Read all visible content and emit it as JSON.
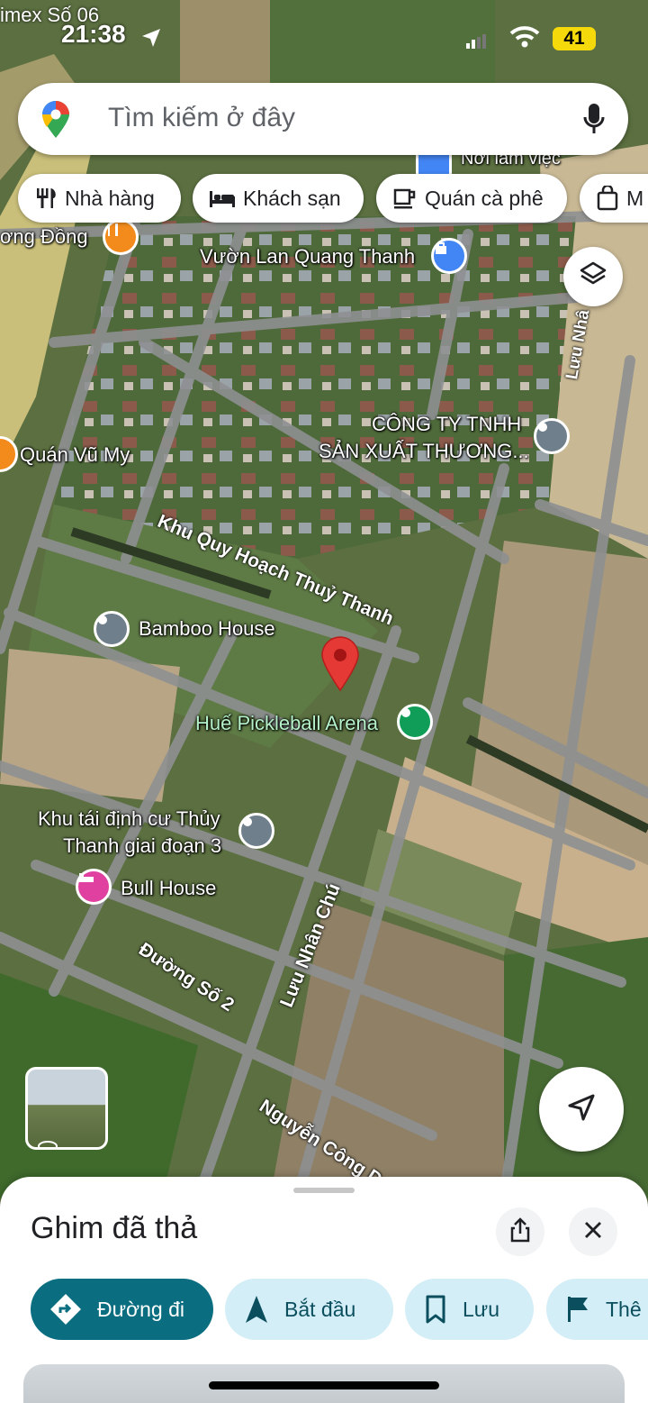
{
  "status_bar": {
    "time": "21:38",
    "battery": "41",
    "top_left_partial": "imex Số 06"
  },
  "search": {
    "placeholder": "Tìm kiếm ở đây"
  },
  "chips": [
    {
      "label": "Nhà hàng",
      "icon": "restaurant-icon"
    },
    {
      "label": "Khách sạn",
      "icon": "hotel-bed-icon"
    },
    {
      "label": "Quán cà phê",
      "icon": "coffee-cup-icon"
    },
    {
      "label": "M",
      "icon": "shopping-bag-icon"
    }
  ],
  "map_labels": {
    "noi_lam_viec": "Nơi làm việc",
    "suong_dong": "ơng Đồng",
    "vuon_lan": "Vườn Lan Quang Thanh",
    "luu_nhan_top": "Lưu Nhâ",
    "cong_ty_1": "CÔNG TY TNHH",
    "cong_ty_2": "SẢN XUẤT THƯƠNG...",
    "quan_vu_my": "Quán Vũ My",
    "khu_quy_hoach": "Khu Quy Hoạch Thuỷ Thanh",
    "bamboo_house": "Bamboo House",
    "pickleball": "Huế Pickleball Arena",
    "khu_tai_dinh_cu_1": "Khu tái định cư Thủy",
    "khu_tai_dinh_cu_2": "Thanh giai đoạn 3",
    "bull_house": "Bull House",
    "duong_so_2": "Đường Số 2",
    "luu_nhan_chu": "Lưu Nhân Chú",
    "nguyen_cong_duan": "Nguyễn Công Duẩ"
  },
  "colors": {
    "accent_teal": "#0b6e80",
    "chip_light_blue": "#d3eef7",
    "pin_red": "#e53935",
    "poi_green": "#0f9d58",
    "poi_pink": "#e040a0",
    "poi_blue": "#4285f4",
    "poi_orange": "#f28b1c"
  },
  "bottom_sheet": {
    "title": "Ghim đã thả",
    "actions": [
      {
        "label": "Đường đi",
        "icon": "directions-icon"
      },
      {
        "label": "Bắt đầu",
        "icon": "navigation-arrow-icon"
      },
      {
        "label": "Lưu",
        "icon": "bookmark-icon"
      },
      {
        "label": "Thê",
        "icon": "flag-icon"
      }
    ]
  }
}
